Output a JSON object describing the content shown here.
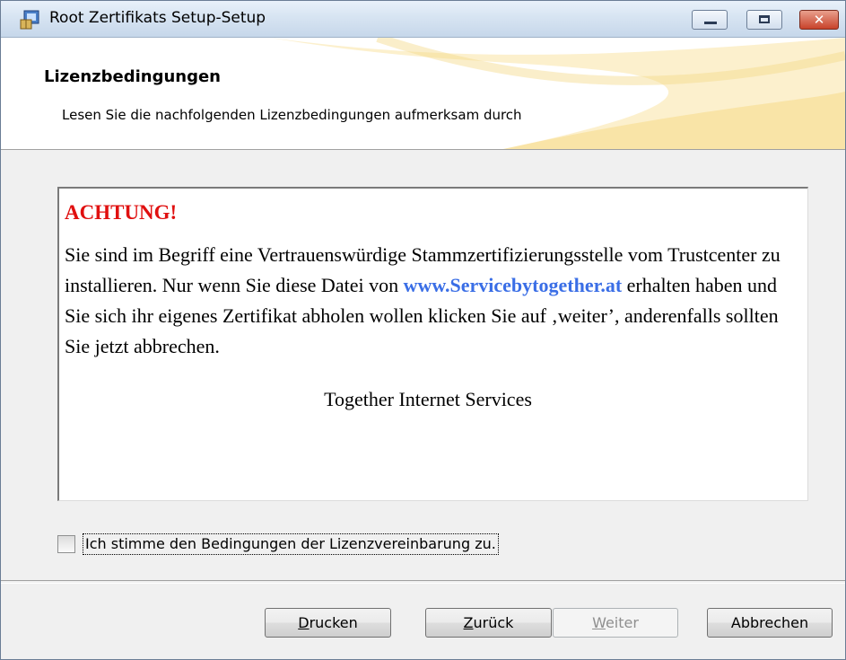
{
  "window": {
    "title": "Root Zertifikats Setup-Setup",
    "controls": {
      "minimize": "minimize-icon",
      "maximize": "maximize-icon",
      "close": "close-icon"
    }
  },
  "header": {
    "title": "Lizenzbedingungen",
    "subtitle": "Lesen Sie die nachfolgenden Lizenzbedingungen aufmerksam durch"
  },
  "license": {
    "heading": "ACHTUNG!",
    "paragraph_start": "Sie sind im Begriff eine Vertrauenswürdige Stammzertifizierungsstelle vom Trustcenter zu installieren. Nur wenn Sie diese Datei von ",
    "link": "www.Servicebytogether.at",
    "paragraph_end": " erhalten haben und Sie sich ihr eigenes Zertifikat abholen wollen klicken Sie auf ‚weiter’, anderenfalls sollten Sie jetzt abbrechen.",
    "signature": "Together Internet Services"
  },
  "agreement": {
    "checked": false,
    "label": "Ich stimme den Bedingungen der Lizenzvereinbarung zu."
  },
  "buttons": {
    "print": {
      "first": "D",
      "rest": "rucken"
    },
    "back": {
      "first": "Z",
      "rest": "urück"
    },
    "next": {
      "first": "W",
      "rest": "eiter",
      "enabled": false
    },
    "cancel": "Abbrechen"
  },
  "colors": {
    "warning": "#e01010",
    "link": "#3a6ee6",
    "close_button": "#c8432b"
  }
}
